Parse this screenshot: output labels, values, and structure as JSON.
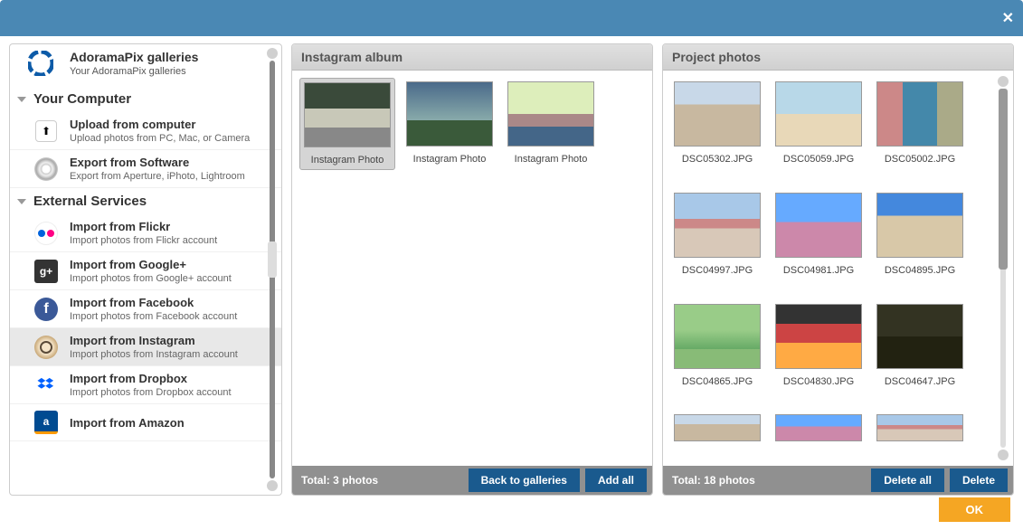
{
  "close_label": "✕",
  "sidebar": {
    "gallery_title": "AdoramaPix galleries",
    "gallery_sub": "Your AdoramaPix galleries",
    "sections": {
      "computer": {
        "title": "Your Computer",
        "upload": {
          "t": "Upload from computer",
          "d": "Upload photos from PC, Mac, or Camera"
        },
        "export": {
          "t": "Export from Software",
          "d": "Export from Aperture, iPhoto, Lightroom"
        }
      },
      "external": {
        "title": "External Services",
        "flickr": {
          "t": "Import from Flickr",
          "d": "Import photos from Flickr account"
        },
        "gplus": {
          "t": "Import from Google+",
          "d": "Import photos from Google+ account"
        },
        "facebook": {
          "t": "Import from Facebook",
          "d": "Import photos from Facebook account"
        },
        "instagram": {
          "t": "Import from Instagram",
          "d": "Import photos from Instagram account"
        },
        "dropbox": {
          "t": "Import from Dropbox",
          "d": "Import photos from Dropbox account"
        },
        "amazon": {
          "t": "Import from Amazon",
          "d": ""
        }
      }
    }
  },
  "middle": {
    "header": "Instagram album",
    "photos": [
      {
        "label": "Instagram Photo"
      },
      {
        "label": "Instagram Photo"
      },
      {
        "label": "Instagram Photo"
      }
    ],
    "total": "Total: 3 photos",
    "back_btn": "Back to galleries",
    "addall_btn": "Add all"
  },
  "right": {
    "header": "Project photos",
    "photos": [
      {
        "label": "DSC05302.JPG"
      },
      {
        "label": "DSC05059.JPG"
      },
      {
        "label": "DSC05002.JPG"
      },
      {
        "label": "DSC04997.JPG"
      },
      {
        "label": "DSC04981.JPG"
      },
      {
        "label": "DSC04895.JPG"
      },
      {
        "label": "DSC04865.JPG"
      },
      {
        "label": "DSC04830.JPG"
      },
      {
        "label": "DSC04647.JPG"
      }
    ],
    "total": "Total: 18 photos",
    "deleteall_btn": "Delete all",
    "delete_btn": "Delete"
  },
  "ok_btn": "OK"
}
